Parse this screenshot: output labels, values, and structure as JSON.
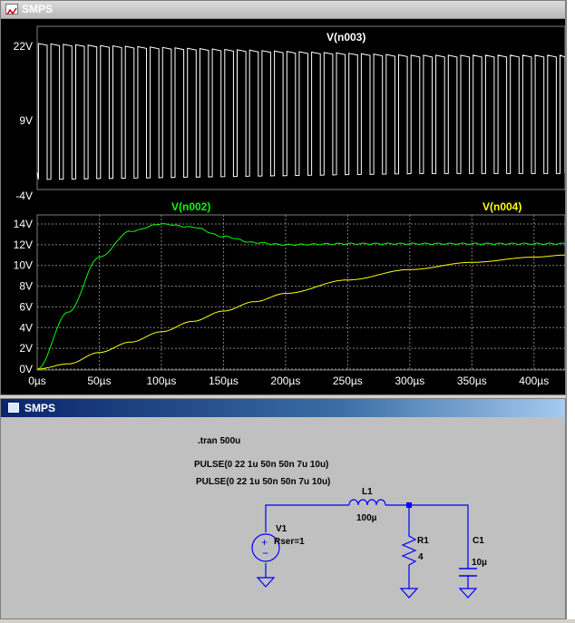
{
  "plot_window": {
    "title": "SMPS",
    "top_pane": {
      "trace_label": "V(n003)",
      "y_ticks": [
        "22V",
        "9V",
        "-4V"
      ]
    },
    "bottom_pane": {
      "trace_labels": [
        "V(n002)",
        "V(n004)"
      ],
      "y_ticks": [
        "14V",
        "12V",
        "10V",
        "8V",
        "6V",
        "4V",
        "2V",
        "0V"
      ],
      "x_ticks": [
        "0µs",
        "50µs",
        "100µs",
        "150µs",
        "200µs",
        "250µs",
        "300µs",
        "350µs",
        "400µs"
      ]
    },
    "colors": {
      "background": "#000000",
      "v_n003": "#ffffff",
      "v_n002": "#00ff00",
      "v_n004": "#ffff00",
      "grid": "#808080"
    }
  },
  "chart_data": [
    {
      "type": "line",
      "series": [
        {
          "name": "V(n003)",
          "description_values": {
            "high": 22,
            "low": -1
          }
        }
      ],
      "ylim": [
        -4,
        22
      ],
      "xlim": [
        0,
        425
      ]
    },
    {
      "type": "line",
      "x": [
        0,
        25,
        50,
        75,
        100,
        125,
        150,
        175,
        200,
        250,
        300,
        350,
        400,
        425
      ],
      "series": [
        {
          "name": "V(n002)",
          "values": [
            0,
            5.5,
            10.8,
            13.3,
            14.0,
            13.7,
            12.8,
            12.2,
            12.0,
            12.1,
            12.1,
            12.1,
            12.1,
            12.1
          ]
        },
        {
          "name": "V(n004)",
          "values": [
            0,
            0.5,
            1.6,
            2.6,
            3.6,
            4.6,
            5.6,
            6.5,
            7.3,
            8.6,
            9.6,
            10.3,
            10.8,
            11.0
          ]
        }
      ],
      "ylim": [
        0,
        15
      ],
      "xlim": [
        0,
        425
      ]
    }
  ],
  "schematic_window": {
    "title": "SMPS",
    "directive": ".tran 500u",
    "pulse_lines": [
      "PULSE(0 22 1u 50n 50n 7u 10u)",
      "PULSE(0 22 1u 50n 50n 7u 10u)"
    ],
    "components": {
      "v1": {
        "name": "V1",
        "value": "Rser=1"
      },
      "l1": {
        "name": "L1",
        "value": "100µ"
      },
      "r1": {
        "name": "R1",
        "value": "4"
      },
      "c1": {
        "name": "C1",
        "value": "10µ"
      }
    },
    "colors": {
      "wire": "#0000ff",
      "text": "#000000"
    }
  }
}
